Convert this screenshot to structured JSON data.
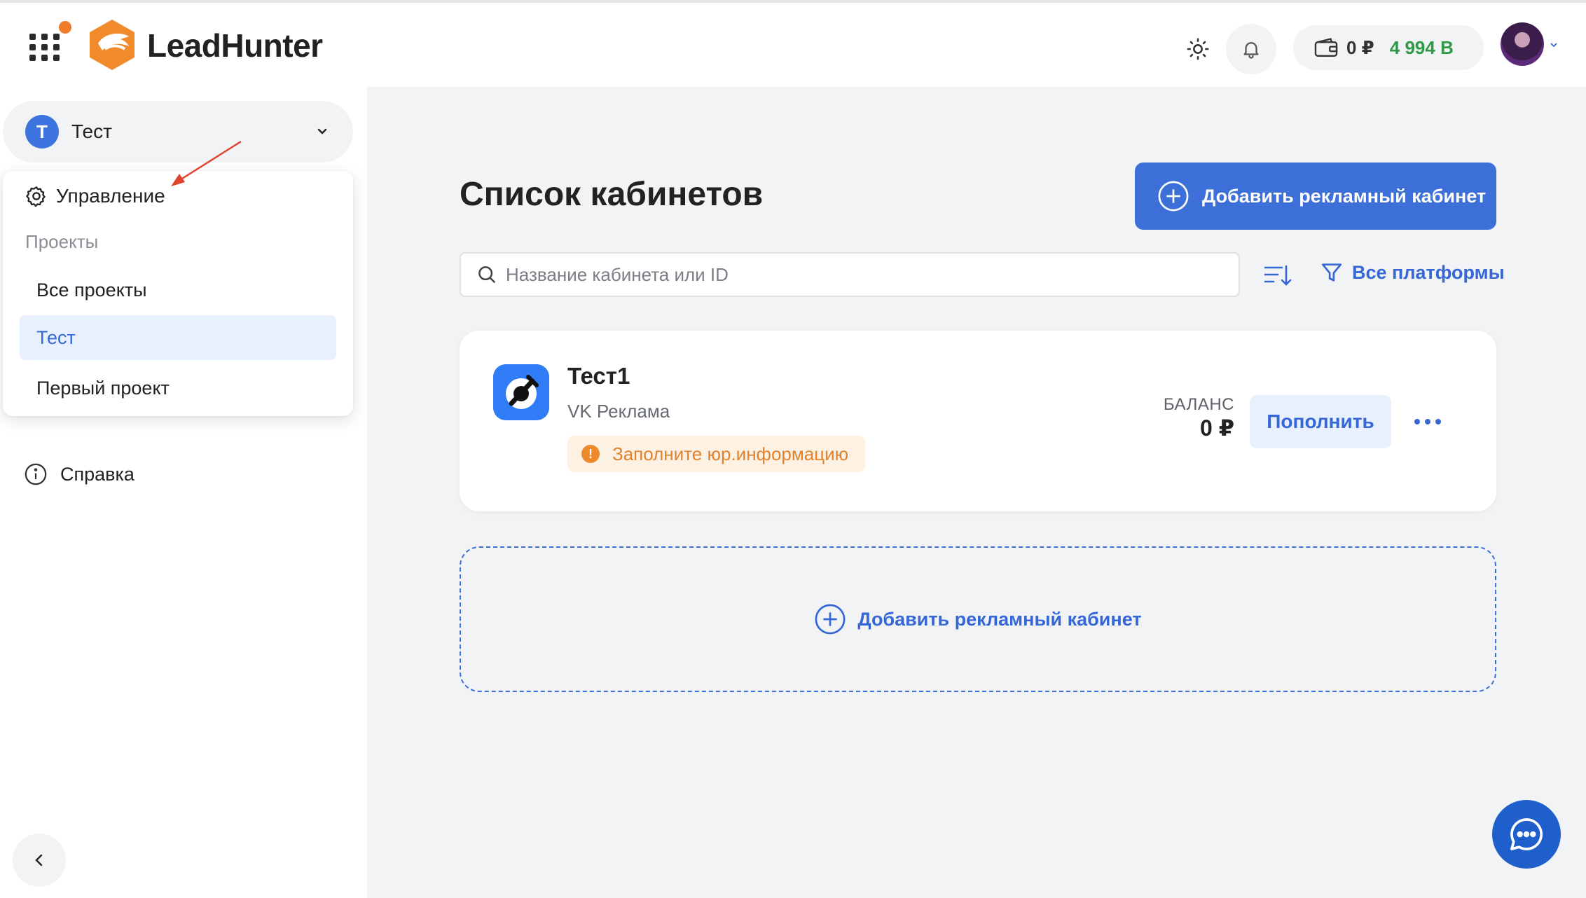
{
  "header": {
    "brand": "LeadHunter",
    "wallet": {
      "rub": "0 ₽",
      "bonus": "4 994 B"
    }
  },
  "sidebar": {
    "project": {
      "initial": "T",
      "name": "Тест"
    },
    "dropdown": {
      "manage": "Управление",
      "section": "Проекты",
      "items": [
        "Все проекты",
        "Тест",
        "Первый проект"
      ]
    },
    "help": "Справка"
  },
  "main": {
    "title": "Список кабинетов",
    "add_button": "Добавить рекламный кабинет",
    "search_placeholder": "Название кабинета или ID",
    "platforms_filter": "Все платформы",
    "accounts": [
      {
        "name": "Тест1",
        "platform": "VK Реклама",
        "warning": "Заполните юр.информацию",
        "balance_label": "БАЛАНС",
        "balance": "0 ₽",
        "topup": "Пополнить"
      }
    ],
    "add_dashed": "Добавить рекламный кабинет"
  },
  "colors": {
    "accent": "#3d6fd9",
    "bonus": "#2e9a46",
    "warning": "#ef8a2c",
    "vk": "#2f7cf6"
  }
}
